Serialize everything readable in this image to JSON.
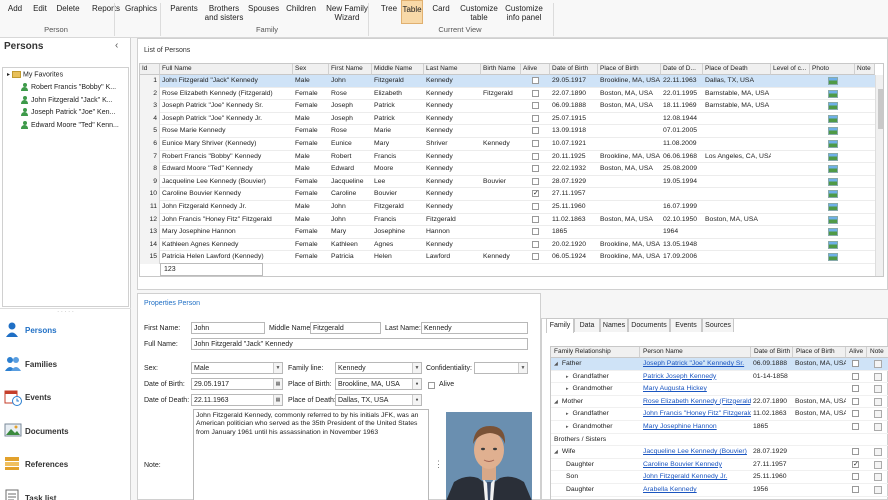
{
  "ribbon": {
    "buttons": [
      {
        "label": "Add",
        "dd": ""
      },
      {
        "label": "Edit",
        "dd": ""
      },
      {
        "label": "Delete",
        "dd": ""
      },
      {
        "label": "Reports",
        "dd": "▾"
      },
      {
        "label": "Graphics",
        "dd": "▾"
      },
      {
        "label": "Parents",
        "dd": "▾"
      },
      {
        "label": "Brothers\nand sisters",
        "dd": "▾"
      },
      {
        "label": "Spouses",
        "dd": "▾"
      },
      {
        "label": "Children",
        "dd": "▾"
      },
      {
        "label": "New Family\nWizard",
        "dd": ""
      },
      {
        "label": "Tree",
        "dd": ""
      },
      {
        "label": "Table",
        "dd": ""
      },
      {
        "label": "Card",
        "dd": ""
      },
      {
        "label": "Customize\ntable",
        "dd": "▾"
      },
      {
        "label": "Customize\ninfo panel",
        "dd": "▾"
      }
    ],
    "groups": [
      "Person",
      "Family",
      "Current View"
    ]
  },
  "left": {
    "title": "Persons",
    "collapse": "‹",
    "tree_root": "My Favorites",
    "tree_items": [
      "Robert Francis \"Bobby\" K...",
      "John Fitzgerald \"Jack\" K...",
      "Joseph Patrick \"Joe\" Ken...",
      "Edward Moore \"Ted\" Kenn..."
    ],
    "nav": [
      "Persons",
      "Families",
      "Events",
      "Documents",
      "References",
      "Task list"
    ]
  },
  "list": {
    "title": "List of Persons",
    "columns": [
      "Id",
      "Full Name",
      "Sex",
      "First Name",
      "Middle Name",
      "Last Name",
      "Birth Name",
      "Alive",
      "Date of Birth",
      "Place of Birth",
      "Date of D...",
      "Place of Death",
      "Level of c...",
      "Photo",
      "Note"
    ],
    "rows": [
      [
        "1",
        "John Fitzgerald \"Jack\" Kennedy",
        "Male",
        "John",
        "Fitzgerald",
        "Kennedy",
        "",
        "0",
        "29.05.1917",
        "Brookline, MA, USA",
        "22.11.1963",
        "Dallas, TX, USA",
        "",
        "1",
        ""
      ],
      [
        "2",
        "Rose Elizabeth Kennedy (Fitzgerald)",
        "Female",
        "Rose",
        "Elizabeth",
        "Kennedy",
        "Fitzgerald",
        "0",
        "22.07.1890",
        "Boston, MA, USA",
        "22.01.1995",
        "Barnstable, MA, USA",
        "",
        "1",
        ""
      ],
      [
        "3",
        "Joseph Patrick \"Joe\" Kennedy Sr.",
        "Female",
        "Joseph",
        "Patrick",
        "Kennedy",
        "",
        "0",
        "06.09.1888",
        "Boston, MA, USA",
        "18.11.1969",
        "Barnstable, MA, USA",
        "",
        "1",
        ""
      ],
      [
        "4",
        "Joseph Patrick \"Joe\" Kennedy Jr.",
        "Male",
        "Joseph",
        "Patrick",
        "Kennedy",
        "",
        "0",
        "25.07.1915",
        "",
        "12.08.1944",
        "",
        "",
        "1",
        ""
      ],
      [
        "5",
        "Rose Marie Kennedy",
        "Female",
        "Rose",
        "Marie",
        "Kennedy",
        "",
        "0",
        "13.09.1918",
        "",
        "07.01.2005",
        "",
        "",
        "1",
        ""
      ],
      [
        "6",
        "Eunice Mary Shriver (Kennedy)",
        "Female",
        "Eunice",
        "Mary",
        "Shriver",
        "Kennedy",
        "0",
        "10.07.1921",
        "",
        "11.08.2009",
        "",
        "",
        "1",
        ""
      ],
      [
        "7",
        "Robert Francis \"Bobby\" Kennedy",
        "Male",
        "Robert",
        "Francis",
        "Kennedy",
        "",
        "0",
        "20.11.1925",
        "Brookline, MA, USA",
        "06.06.1968",
        "Los Angeles, CA, USA",
        "",
        "1",
        ""
      ],
      [
        "8",
        "Edward Moore \"Ted\" Kennedy",
        "Male",
        "Edward",
        "Moore",
        "Kennedy",
        "",
        "0",
        "22.02.1932",
        "Boston, MA, USA",
        "25.08.2009",
        "",
        "",
        "1",
        ""
      ],
      [
        "9",
        "Jacqueline Lee Kennedy (Bouvier)",
        "Female",
        "Jacqueline",
        "Lee",
        "Kennedy",
        "Bouvier",
        "0",
        "28.07.1929",
        "",
        "19.05.1994",
        "",
        "",
        "1",
        ""
      ],
      [
        "10",
        "Caroline Bouvier Kennedy",
        "Female",
        "Caroline",
        "Bouvier",
        "Kennedy",
        "",
        "1",
        "27.11.1957",
        "",
        "",
        "",
        "",
        "1",
        ""
      ],
      [
        "11",
        "John Fitzgerald Kennedy Jr.",
        "Male",
        "John",
        "Fitzgerald",
        "Kennedy",
        "",
        "0",
        "25.11.1960",
        "",
        "16.07.1999",
        "",
        "",
        "1",
        ""
      ],
      [
        "12",
        "John Francis \"Honey Fitz\" Fitzgerald",
        "Male",
        "John",
        "Francis",
        "Fitzgerald",
        "",
        "0",
        "11.02.1863",
        "Boston, MA, USA",
        "02.10.1950",
        "Boston, MA, USA",
        "",
        "1",
        ""
      ],
      [
        "13",
        "Mary Josephine Hannon",
        "Female",
        "Mary",
        "Josephine",
        "Hannon",
        "",
        "0",
        "1865",
        "",
        "1964",
        "",
        "",
        "1",
        ""
      ],
      [
        "14",
        "Kathleen Agnes Kennedy",
        "Female",
        "Kathleen",
        "Agnes",
        "Kennedy",
        "",
        "0",
        "20.02.1920",
        "Brookline, MA, USA",
        "13.05.1948",
        "",
        "",
        "1",
        ""
      ],
      [
        "15",
        "Patricia Helen Lawford (Kennedy)",
        "Female",
        "Patricia",
        "Helen",
        "Lawford",
        "Kennedy",
        "0",
        "06.05.1924",
        "Brookline, MA, USA",
        "17.09.2006",
        "",
        "",
        "1",
        ""
      ]
    ],
    "filter_value": "123"
  },
  "details": {
    "title": "Properties Person",
    "first_name_label": "First Name:",
    "first_name": "John",
    "middle_name_label": "Middle Name:",
    "middle_name": "Fitzgerald",
    "last_name_label": "Last Name:",
    "last_name": "Kennedy",
    "full_name_label": "Full Name:",
    "full_name": "John Fitzgerald \"Jack\" Kennedy",
    "sex_label": "Sex:",
    "sex": "Male",
    "family_line_label": "Family line:",
    "family_line": "Kennedy",
    "confidentiality_label": "Confidentiality:",
    "confidentiality": "",
    "dob_label": "Date of Birth:",
    "dob": "29.05.1917",
    "pob_label": "Place of Birth:",
    "pob": "Brookline, MA, USA",
    "alive_label": "Alive",
    "dod_label": "Date of Death:",
    "dod": "22.11.1963",
    "pod_label": "Place of Death:",
    "pod": "Dallas, TX, USA",
    "note_label": "Note:",
    "note": "John Fitzgerald Kennedy, commonly referred to by his initials JFK, was an American politician who served as the 35th President of the United States from January 1961 until his assassination in November 1963"
  },
  "family": {
    "tabs": [
      "Family",
      "Data",
      "Names",
      "Documents",
      "Events",
      "Sources"
    ],
    "columns": [
      "Family Relationship",
      "Person Name",
      "Date of Birth",
      "Place of Birth",
      "Alive",
      "Note"
    ],
    "rows": [
      {
        "indent": 0,
        "exp": "◢",
        "rel": "Father",
        "name": "Joseph Patrick \"Joe\" Kennedy Sr.",
        "dob": "06.09.1888",
        "pob": "Boston, MA, USA",
        "alive": "0"
      },
      {
        "indent": 1,
        "exp": "▸",
        "rel": "Grandfather",
        "name": "Patrick Joseph Kennedy",
        "dob": "01-14-1858",
        "pob": "",
        "alive": "0"
      },
      {
        "indent": 1,
        "exp": "▸",
        "rel": "Grandmother",
        "name": "Mary Augusta Hickey",
        "dob": "",
        "pob": "",
        "alive": "0"
      },
      {
        "indent": 0,
        "exp": "◢",
        "rel": "Mother",
        "name": "Rose Elizabeth Kennedy (Fitzgerald)",
        "dob": "22.07.1890",
        "pob": "Boston, MA, USA",
        "alive": "0"
      },
      {
        "indent": 1,
        "exp": "▸",
        "rel": "Grandfather",
        "name": "John Francis \"Honey Fitz\" Fitzgerald",
        "dob": "11.02.1863",
        "pob": "Boston, MA, USA",
        "alive": "0"
      },
      {
        "indent": 1,
        "exp": "▸",
        "rel": "Grandmother",
        "name": "Mary Josephine Hannon",
        "dob": "1865",
        "pob": "",
        "alive": "0"
      },
      {
        "indent": 0,
        "exp": "",
        "rel": "Brothers / Sisters",
        "name": "",
        "dob": "",
        "pob": "",
        "alive": ""
      },
      {
        "indent": 0,
        "exp": "◢",
        "rel": "Wife",
        "name": "Jacqueline Lee Kennedy (Bouvier)",
        "dob": "28.07.1929",
        "pob": "",
        "alive": "0"
      },
      {
        "indent": 1,
        "exp": "",
        "rel": "Daughter",
        "name": "Caroline Bouvier Kennedy",
        "dob": "27.11.1957",
        "pob": "",
        "alive": "1"
      },
      {
        "indent": 1,
        "exp": "",
        "rel": "Son",
        "name": "John Fitzgerald Kennedy Jr.",
        "dob": "25.11.1960",
        "pob": "",
        "alive": "0"
      },
      {
        "indent": 1,
        "exp": "",
        "rel": "Daughter",
        "name": "Arabella Kennedy",
        "dob": "1956",
        "pob": "",
        "alive": "0"
      }
    ]
  }
}
